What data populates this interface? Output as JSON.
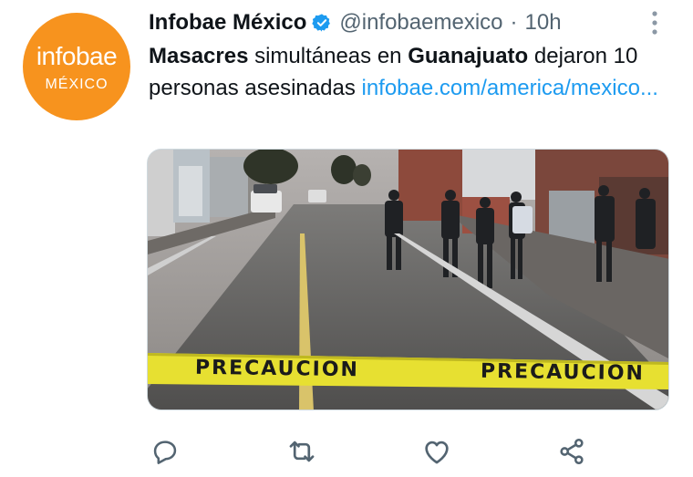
{
  "avatar": {
    "brand": "infobae",
    "country": "MÉXICO"
  },
  "tweet": {
    "display_name": "Infobae México",
    "handle": "@infobaemexico",
    "separator": "·",
    "time": "10h",
    "text": {
      "bold1": "Masacres",
      "part1": " simultáneas en ",
      "bold2": "Guanajuato",
      "part2": " dejaron 10 personas asesinadas ",
      "link": "infobae.com/america/mexico..."
    }
  },
  "media": {
    "tape_text": "PRECAUCION"
  },
  "actions": [
    "reply-icon",
    "retweet-icon",
    "like-icon",
    "share-icon"
  ],
  "colors": {
    "accent": "#1d9bf0",
    "brand_orange": "#f7931e",
    "muted": "#536471"
  }
}
